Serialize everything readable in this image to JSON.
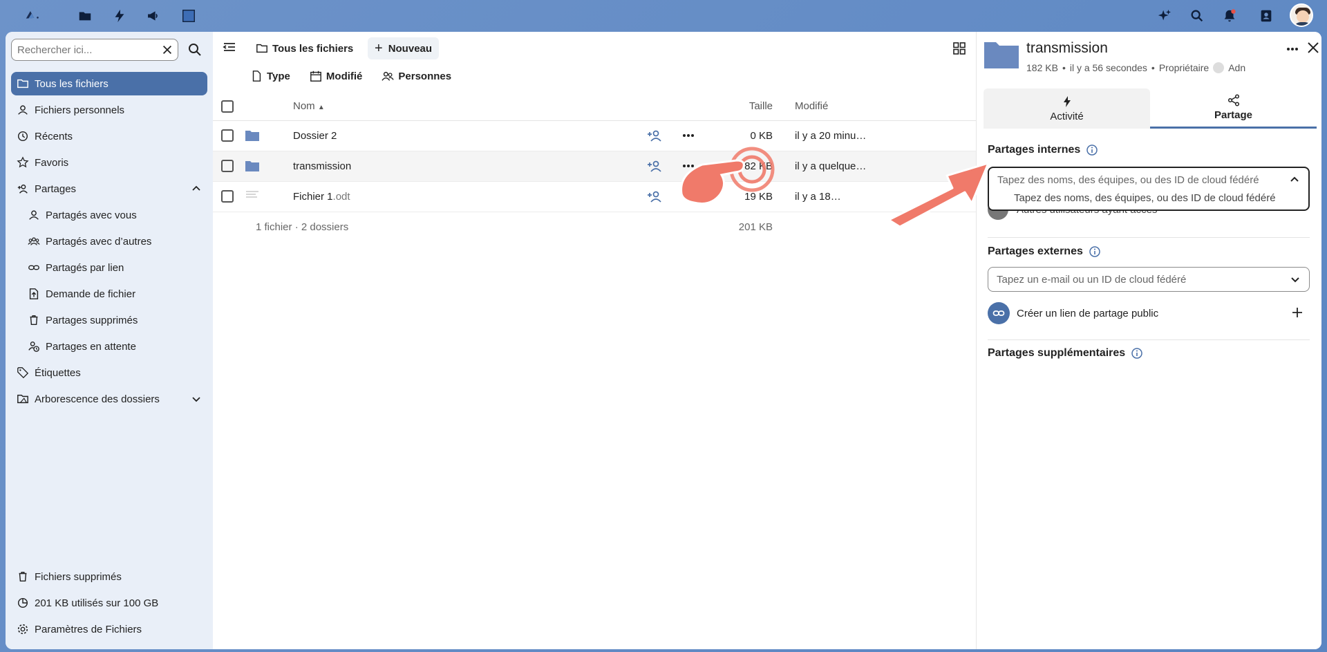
{
  "colors": {
    "accent": "#4a70a8",
    "annotation": "#f07a6a",
    "desktop": "#6d93c9"
  },
  "topbar": {
    "icons": [
      "logo-icon",
      "files-app-icon",
      "activity-app-icon",
      "announcements-app-icon",
      "window-app-icon",
      "assistant-icon",
      "search-icon",
      "notifications-icon",
      "contacts-icon",
      "user-avatar"
    ]
  },
  "sidebar": {
    "search": {
      "placeholder": "Rechercher ici..."
    },
    "items": [
      {
        "label": "Tous les fichiers",
        "icon": "folder-icon",
        "active": true
      },
      {
        "label": "Fichiers personnels",
        "icon": "user-icon"
      },
      {
        "label": "Récents",
        "icon": "history-icon"
      },
      {
        "label": "Favoris",
        "icon": "star-icon"
      },
      {
        "label": "Partages",
        "icon": "share-user-icon",
        "expanded": true
      },
      {
        "label": "Partagés avec vous",
        "icon": "user-icon"
      },
      {
        "label": "Partagés avec d’autres",
        "icon": "group-icon"
      },
      {
        "label": "Partagés par lien",
        "icon": "link-icon"
      },
      {
        "label": "Demande de fichier",
        "icon": "file-upload-icon"
      },
      {
        "label": "Partages supprimés",
        "icon": "trash-icon"
      },
      {
        "label": "Partages en attente",
        "icon": "user-clock-icon"
      },
      {
        "label": "Étiquettes",
        "icon": "tag-icon"
      },
      {
        "label": "Arborescence des dossiers",
        "icon": "folder-tree-icon"
      }
    ],
    "bottom": {
      "deleted": "Fichiers supprimés",
      "quota": "201 KB utilisés sur 100 GB",
      "settings": "Paramètres de Fichiers"
    }
  },
  "files": {
    "breadcrumb": "Tous les fichiers",
    "new_label": "Nouveau",
    "filters": [
      "Type",
      "Modifié",
      "Personnes"
    ],
    "columns": {
      "name": "Nom",
      "size": "Taille",
      "modified": "Modifié"
    },
    "rows": [
      {
        "name": "Dossier 2",
        "ext": "",
        "kind": "folder",
        "size": "0 KB",
        "modified": "il y a 20 minu…"
      },
      {
        "name": "transmission",
        "ext": "",
        "kind": "folder",
        "size": "182 KB",
        "modified": "il y a quelque…"
      },
      {
        "name": "Fichier 1",
        "ext": ".odt",
        "kind": "document",
        "size": "19 KB",
        "modified": "il y a 18…"
      }
    ],
    "summary": {
      "counts": "1 fichier · 2 dossiers",
      "total": "201 KB"
    }
  },
  "panel": {
    "title": "transmission",
    "meta": {
      "size": "182 KB",
      "time": "il y a 56 secondes",
      "owner_label": "Propriétaire",
      "owner": "Adn"
    },
    "tabs": {
      "activity": "Activité",
      "sharing": "Partage"
    },
    "internal": {
      "title": "Partages internes",
      "placeholder": "Tapez des noms, des équipes, ou des ID de cloud fédéré",
      "option": "Tapez des noms, des équipes, ou des ID de cloud fédéré",
      "others": "Autres utilisateurs ayant accès"
    },
    "external": {
      "title": "Partages externes",
      "placeholder": "Tapez un e-mail ou un ID de cloud fédéré",
      "public_link": "Créer un lien de partage public"
    },
    "additional": {
      "title": "Partages supplémentaires"
    }
  }
}
